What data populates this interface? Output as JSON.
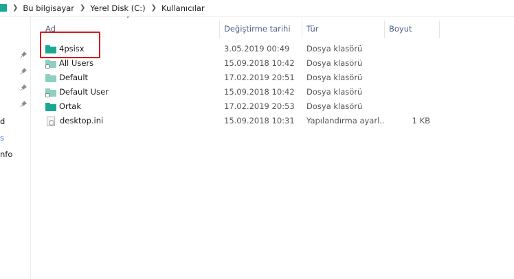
{
  "breadcrumb": {
    "items": [
      "Bu bilgisayar",
      "Yerel Disk (C:)",
      "Kullanıcılar"
    ]
  },
  "nav": {
    "partial_labels": [
      "d",
      "s",
      "nfo"
    ]
  },
  "columns": {
    "name": "Ad",
    "date": "Değiştirme tarihi",
    "type": "Tür",
    "size": "Boyut"
  },
  "files": [
    {
      "name": "4psisx",
      "date": "3.05.2019 00:49",
      "type": "Dosya klasörü",
      "size": "",
      "icon": "folder-icon"
    },
    {
      "name": "All Users",
      "date": "15.09.2018 10:42",
      "type": "Dosya klasörü",
      "size": "",
      "icon": "folder-shortcut-icon"
    },
    {
      "name": "Default",
      "date": "17.02.2019 20:51",
      "type": "Dosya klasörü",
      "size": "",
      "icon": "folder-light-icon"
    },
    {
      "name": "Default User",
      "date": "15.09.2018 10:42",
      "type": "Dosya klasörü",
      "size": "",
      "icon": "folder-shortcut-icon"
    },
    {
      "name": "Ortak",
      "date": "17.02.2019 20:53",
      "type": "Dosya klasörü",
      "size": "",
      "icon": "folder-icon"
    },
    {
      "name": "desktop.ini",
      "date": "15.09.2018 10:31",
      "type": "Yapılandırma ayarl...",
      "size": "1 KB",
      "icon": "settings-file-icon"
    }
  ],
  "colors": {
    "folder": "#1ba891",
    "folder_light": "#8ecfc1",
    "header_text": "#4d6082",
    "highlight": "#d51a1a"
  }
}
